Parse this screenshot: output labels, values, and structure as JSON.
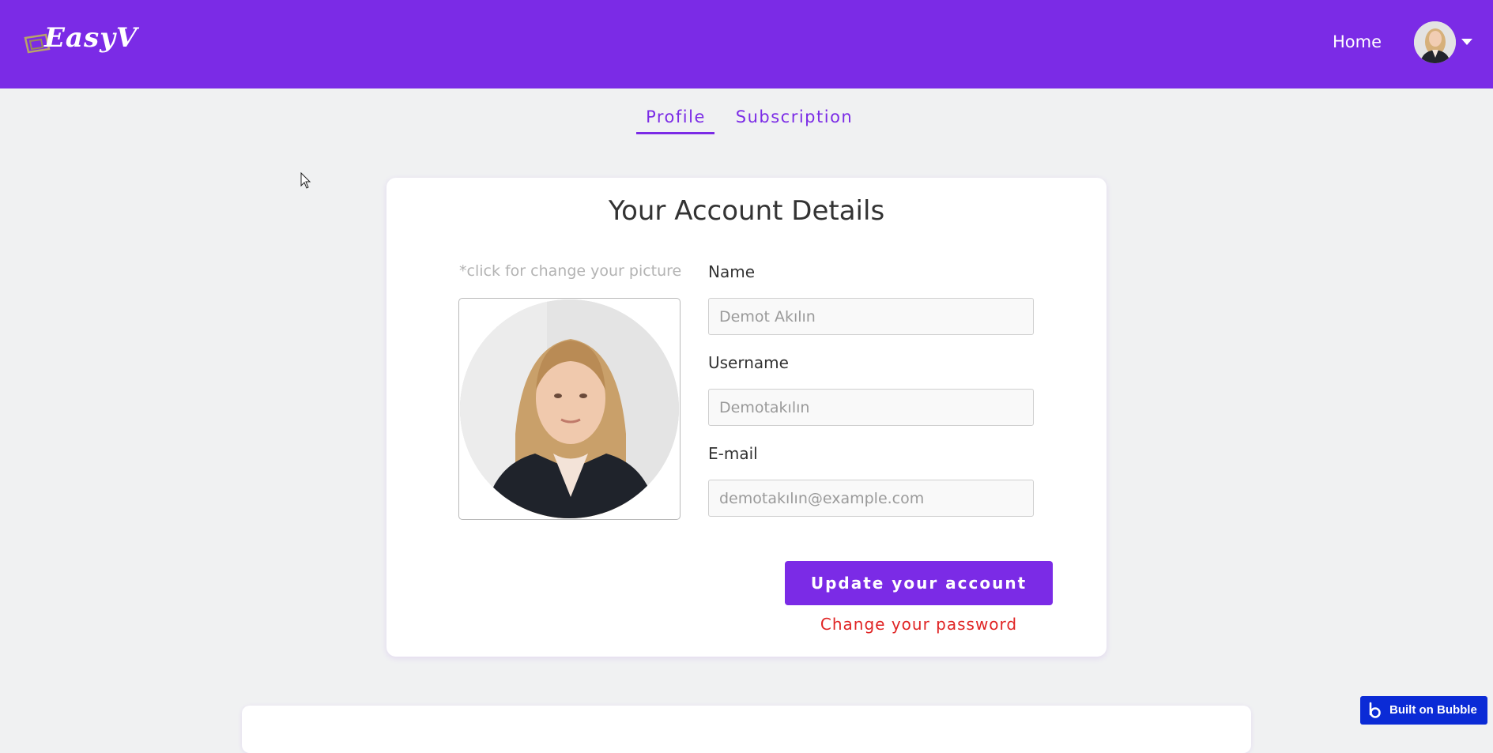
{
  "header": {
    "logo_text": "EasyV",
    "nav_home": "Home"
  },
  "tabs": [
    {
      "label": "Profile",
      "active": true
    },
    {
      "label": "Subscription",
      "active": false
    }
  ],
  "card": {
    "title": "Your Account Details",
    "picture_hint": "*click for change your picture",
    "fields": {
      "name_label": "Name",
      "name_placeholder": "Demot Akılın",
      "username_label": "Username",
      "username_placeholder": "Demotakılın",
      "email_label": "E-mail",
      "email_placeholder": "demotakılın@example.com"
    },
    "update_button": "Update your account",
    "change_password_link": "Change your password"
  },
  "badge": {
    "label": "Built on Bubble"
  },
  "colors": {
    "brand": "#7b2be6",
    "background": "#f0f1f2",
    "danger": "#e02424",
    "bubble": "#0b2bd6"
  }
}
